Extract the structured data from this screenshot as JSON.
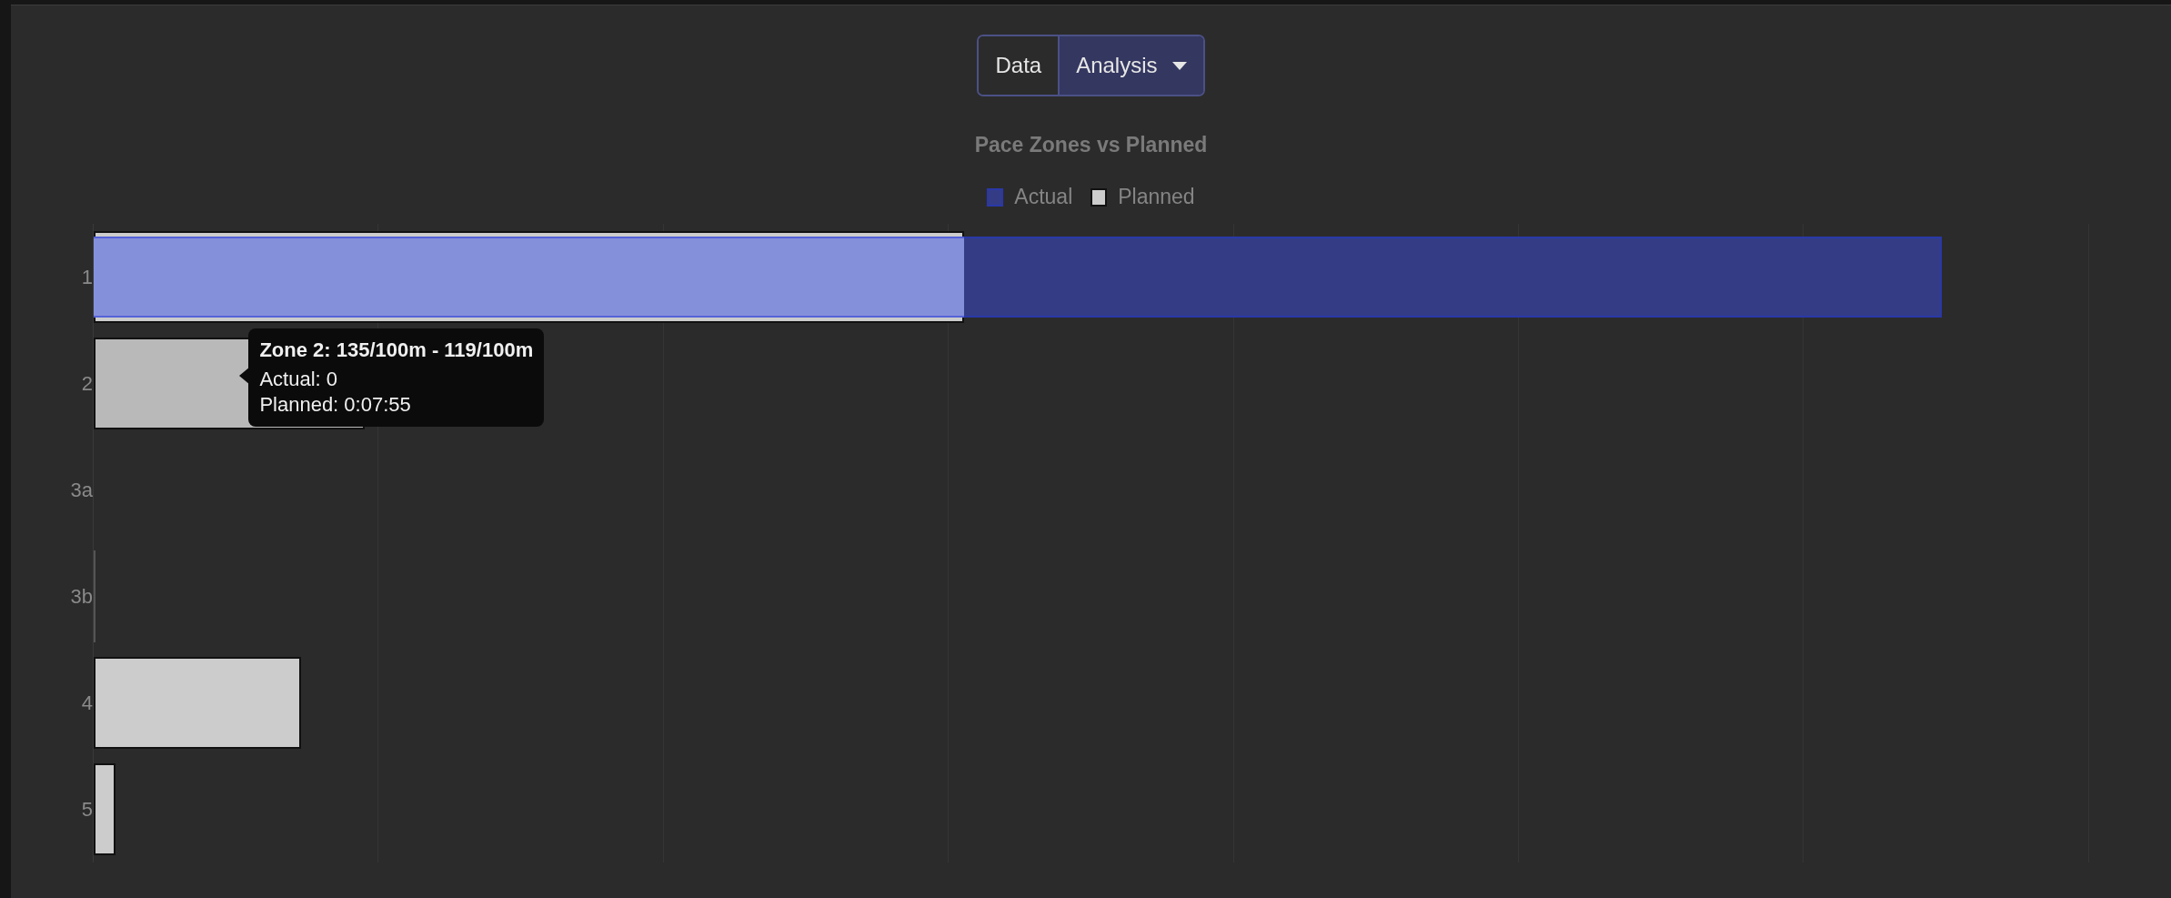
{
  "view_toggle": [
    {
      "label": "Data",
      "selected": false,
      "kind": "button"
    },
    {
      "label": "Analysis",
      "selected": true,
      "kind": "dropdown"
    }
  ],
  "chart": {
    "title": "Pace Zones vs Planned",
    "legend": [
      {
        "label": "Actual",
        "color": "#343c86"
      },
      {
        "label": "Planned",
        "color": "#cccccc"
      }
    ],
    "rows": [
      {
        "label": "1",
        "hovered": false
      },
      {
        "label": "2",
        "hovered": true
      },
      {
        "label": "3a",
        "hovered": false
      },
      {
        "label": "3b",
        "hovered": false
      },
      {
        "label": "4",
        "hovered": false
      },
      {
        "label": "5",
        "hovered": false
      }
    ],
    "tooltip": {
      "title": "Zone 2: 135/100m - 119/100m",
      "lines": [
        "Actual: 0",
        "Planned: 0:07:55"
      ]
    }
  }
}
